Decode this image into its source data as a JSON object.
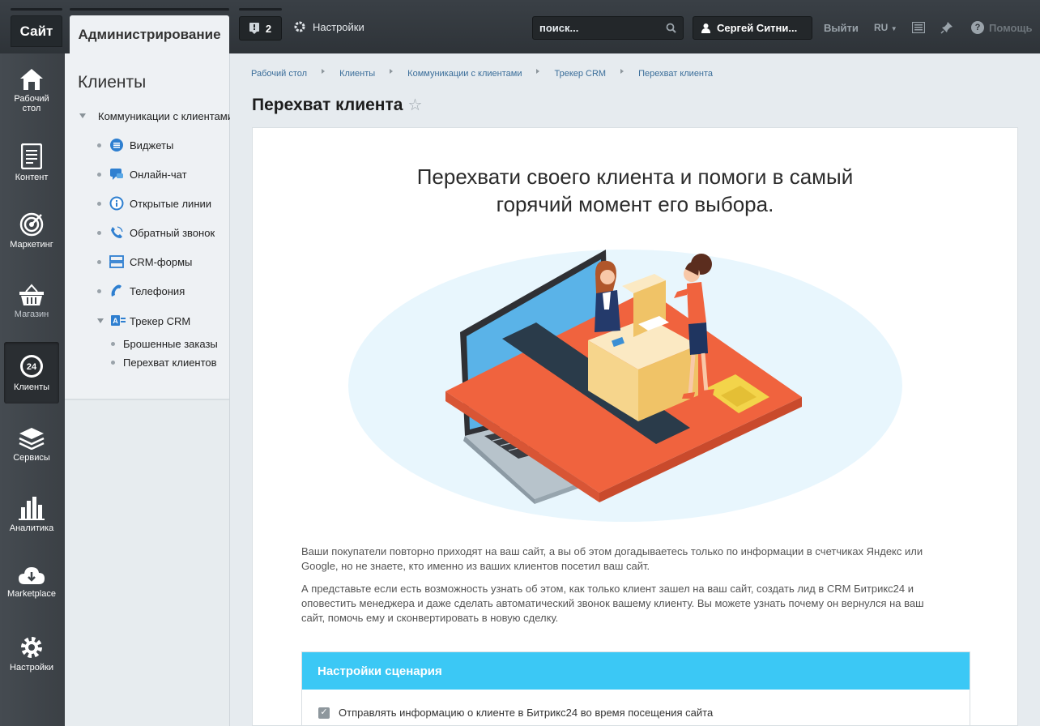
{
  "topbar": {
    "site_tab": "Сайт",
    "admin_tab": "Администрирование",
    "notifications_count": "2",
    "settings_label": "Настройки",
    "search_placeholder": "поиск...",
    "user_name": "Сергей Ситни...",
    "logout_label": "Выйти",
    "language": "RU",
    "help_label": "Помощь"
  },
  "leftnav": {
    "items": [
      {
        "label": "Рабочий стол",
        "icon": "home-icon"
      },
      {
        "label": "Контент",
        "icon": "document-icon"
      },
      {
        "label": "Маркетинг",
        "icon": "target-icon"
      },
      {
        "label": "Магазин",
        "icon": "basket-icon"
      },
      {
        "label": "Клиенты",
        "icon": "clients-24-icon",
        "active": true
      },
      {
        "label": "Сервисы",
        "icon": "layers-icon"
      },
      {
        "label": "Аналитика",
        "icon": "bar-chart-icon"
      },
      {
        "label": "Marketplace",
        "icon": "cloud-download-icon"
      },
      {
        "label": "Настройки",
        "icon": "gear-icon"
      }
    ]
  },
  "submenu": {
    "title": "Клиенты",
    "root": "Коммуникации с клиентами",
    "items": [
      "Виджеты",
      "Онлайн-чат",
      "Открытые линии",
      "Обратный звонок",
      "CRM-формы",
      "Телефония"
    ],
    "tracker": "Трекер CRM",
    "tracker_items": [
      "Брошенные заказы",
      "Перехват клиентов"
    ]
  },
  "breadcrumb": [
    "Рабочий стол",
    "Клиенты",
    "Коммуникации с клиентами",
    "Трекер CRM",
    "Перехват клиента"
  ],
  "page": {
    "title": "Перехват клиента",
    "headline_line1": "Перехвати своего клиента и помоги в самый",
    "headline_line2": "горячий момент его выбора.",
    "paragraph1": "Ваши покупатели повторно приходят на ваш сайт, а вы об этом догадываетесь только по информации в счетчиках Яндекс или Google, но не знаете, кто именно из ваших клиентов посетил ваш сайт.",
    "paragraph2": "А представьте если есть возможность узнать об этом, как только клиент зашел на ваш сайт, создать лид в CRM Битрикс24 и оповестить менеджера и даже сделать автоматический звонок вашему клиенту. Вы можете узнать почему он вернулся на ваш сайт, помочь ему и сконвертировать в новую сделку.",
    "panel_title": "Настройки сценария",
    "checkbox_label": "Отправлять информацию о клиенте в Битрикс24 во время посещения сайта",
    "checkbox_checked": true
  },
  "colors": {
    "accent": "#3bc8f5",
    "topbar": "#33383d",
    "card_red": "#f0633e",
    "laptop": "#2f3034"
  }
}
